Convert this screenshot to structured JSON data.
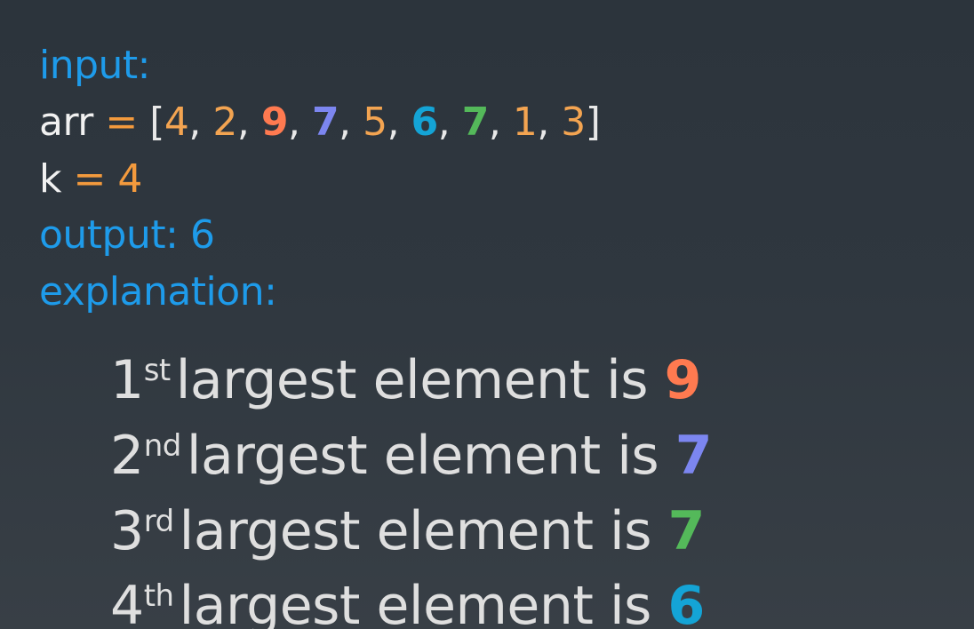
{
  "input_label": "input:",
  "arr": {
    "name": "arr",
    "equals": "=",
    "open_bracket": "[",
    "close_bracket": "]",
    "separator": ",",
    "values": [
      "4",
      "2",
      "9",
      "7",
      "5",
      "6",
      "7",
      "1",
      "3"
    ],
    "value_colors": [
      "#f3a451",
      "#f3a451",
      "#ff7a50",
      "#7c86f0",
      "#f3a451",
      "#14a4d6",
      "#54b95a",
      "#f3a451",
      "#f3a451"
    ]
  },
  "k": {
    "name": "k",
    "equals": "=",
    "value": "4"
  },
  "output": {
    "label": "output:",
    "value": "6"
  },
  "explanation_label": "explanation:",
  "explanation": [
    {
      "ordinal": "1",
      "suffix": "st",
      "text": "largest element is",
      "value": "9",
      "color": "#ff7a50"
    },
    {
      "ordinal": "2",
      "suffix": "nd",
      "text": "largest element is",
      "value": "7",
      "color": "#7c86f0"
    },
    {
      "ordinal": "3",
      "suffix": "rd",
      "text": "largest element is",
      "value": "7",
      "color": "#54b95a"
    },
    {
      "ordinal": "4",
      "suffix": "th",
      "text": "largest element is",
      "value": "6",
      "color": "#14a4d6"
    }
  ]
}
